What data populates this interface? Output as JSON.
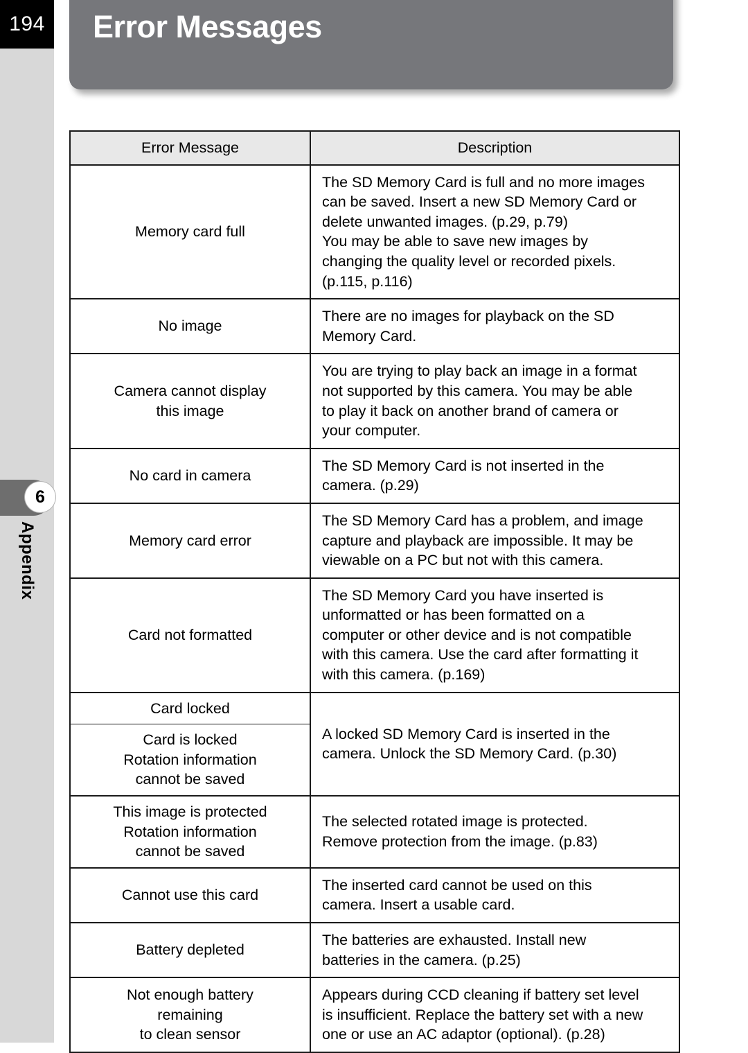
{
  "page": {
    "number": "194",
    "title": "Error Messages"
  },
  "chapter": {
    "badge": "6",
    "label": "Appendix"
  },
  "table": {
    "headers": {
      "message": "Error Message",
      "description": "Description"
    },
    "rows": [
      {
        "message_lines": [
          "Memory card full"
        ],
        "description_lines": [
          "The SD Memory Card is full and no more images",
          "can be saved. Insert a new SD Memory Card or",
          "delete unwanted images. (p.29, p.79)",
          "You may be able to save new images by",
          "changing the quality level or recorded pixels.",
          "(p.115, p.116)"
        ]
      },
      {
        "message_lines": [
          "No image"
        ],
        "description_lines": [
          "There are no images for playback on the SD",
          "Memory Card."
        ]
      },
      {
        "message_lines": [
          "Camera cannot display",
          "this image"
        ],
        "description_lines": [
          "You are trying to play back an image in a format",
          "not supported by this camera. You may be able",
          "to play it back on another brand of camera or",
          "your computer."
        ]
      },
      {
        "message_lines": [
          "No card in camera"
        ],
        "description_lines": [
          "The SD Memory Card is not inserted in the",
          "camera. (p.29)"
        ]
      },
      {
        "message_lines": [
          "Memory card error"
        ],
        "description_lines": [
          "The SD Memory Card has a problem, and image",
          "capture and playback are impossible. It may be",
          "viewable on a PC but not with this camera."
        ]
      },
      {
        "message_lines": [
          "Card not formatted"
        ],
        "description_lines": [
          "The SD Memory Card you have inserted is",
          "unformatted or has been formatted on a",
          "computer or other device and is not compatible",
          "with this camera. Use the card after formatting it",
          "with this camera. (p.169)"
        ]
      },
      {
        "message_lines": [
          "Card locked"
        ],
        "message_lines_2": [
          "Card is locked",
          "Rotation information",
          "cannot be saved"
        ],
        "description_lines": [
          "A locked SD Memory Card is inserted in the",
          "camera. Unlock the SD Memory Card. (p.30)"
        ]
      },
      {
        "message_lines": [
          "This image is protected",
          "Rotation information",
          "cannot be saved"
        ],
        "description_lines": [
          "The selected rotated image is protected.",
          "Remove protection from the image. (p.83)"
        ]
      },
      {
        "message_lines": [
          "Cannot use this card"
        ],
        "description_lines": [
          "The inserted card cannot be used on this",
          "camera. Insert a usable card."
        ]
      },
      {
        "message_lines": [
          "Battery depleted"
        ],
        "description_lines": [
          "The batteries are exhausted. Install new",
          "batteries in the camera. (p.25)"
        ]
      },
      {
        "message_lines": [
          "Not enough battery",
          "remaining",
          "to clean sensor"
        ],
        "description_lines": [
          "Appears during CCD cleaning if battery set level",
          "is insufficient. Replace the battery set with a new",
          "one or use an AC adaptor (optional). (p.28)"
        ]
      }
    ]
  }
}
